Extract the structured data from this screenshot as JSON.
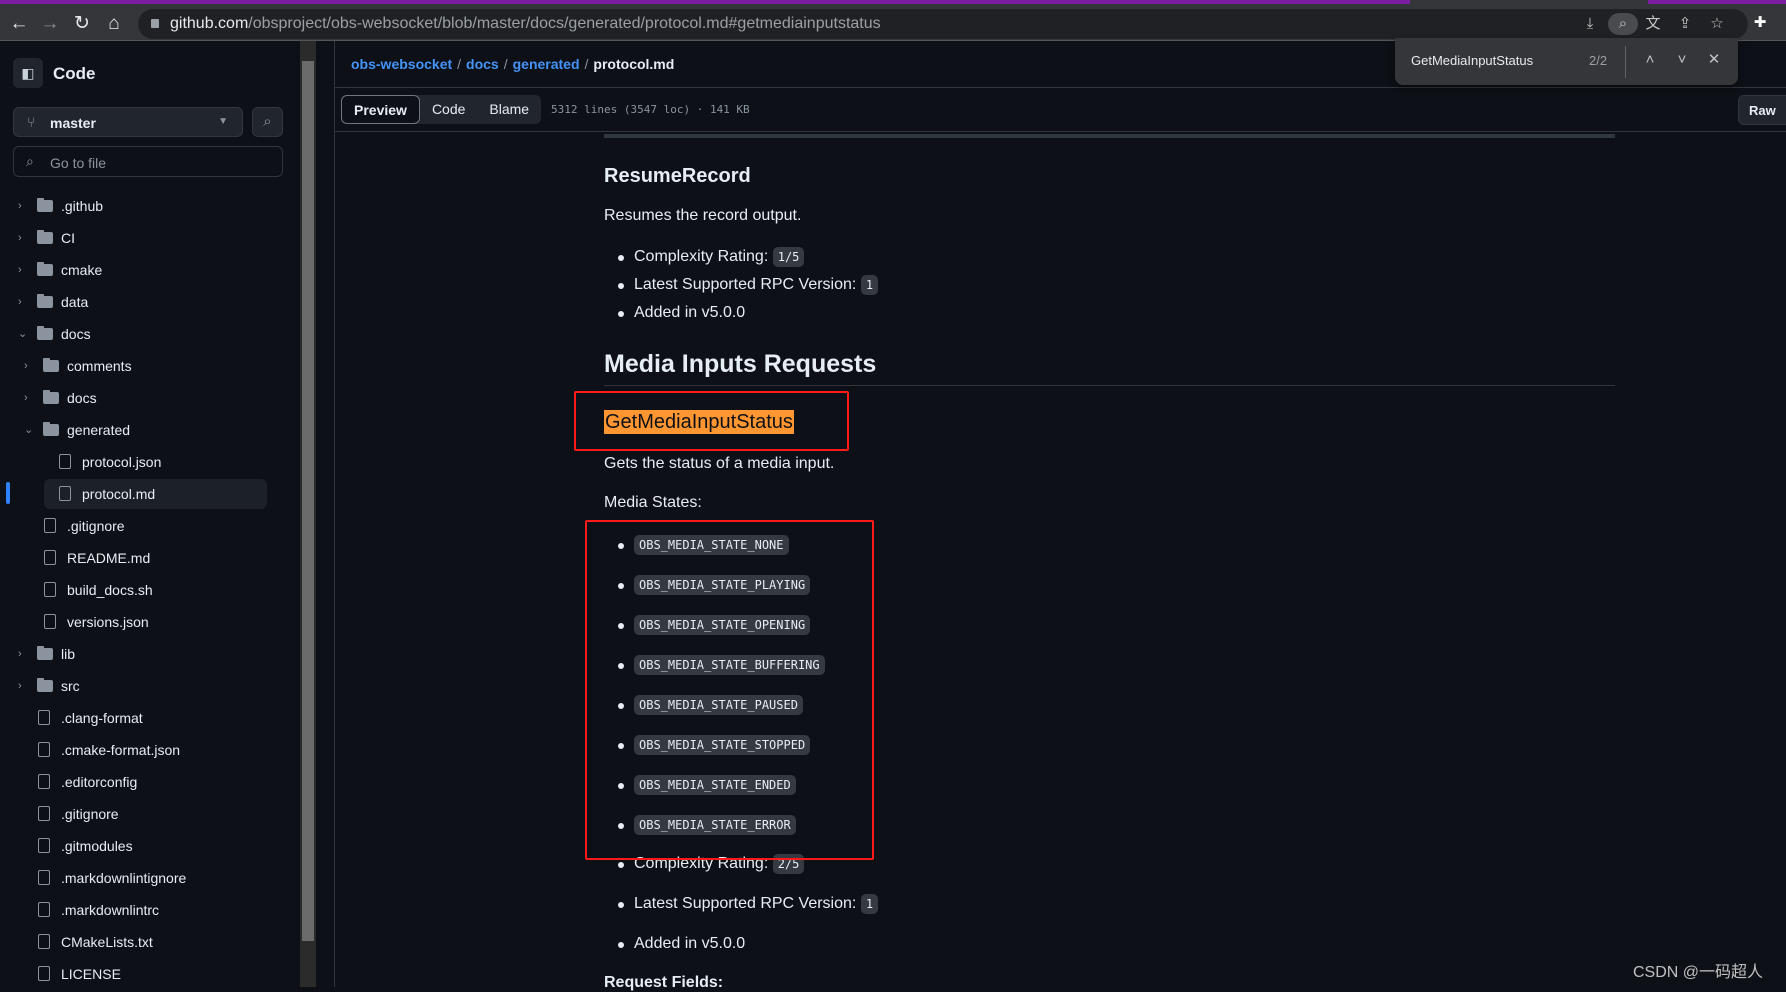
{
  "browser": {
    "url_host": "github.com",
    "url_path": "/obsproject/obs-websocket/blob/master/docs/generated/protocol.md#getmediainputstatus",
    "find": {
      "query": "GetMediaInputStatus",
      "count": "2/2"
    }
  },
  "sidebar": {
    "title": "Code",
    "branch": "master",
    "goto_placeholder": "Go to file",
    "items": [
      {
        "label": ".github",
        "type": "folder",
        "depth": 0,
        "expanded": false
      },
      {
        "label": "CI",
        "type": "folder",
        "depth": 0,
        "expanded": false
      },
      {
        "label": "cmake",
        "type": "folder",
        "depth": 0,
        "expanded": false
      },
      {
        "label": "data",
        "type": "folder",
        "depth": 0,
        "expanded": false
      },
      {
        "label": "docs",
        "type": "folder",
        "depth": 0,
        "expanded": true
      },
      {
        "label": "comments",
        "type": "folder",
        "depth": 1,
        "expanded": false
      },
      {
        "label": "docs",
        "type": "folder",
        "depth": 1,
        "expanded": false
      },
      {
        "label": "generated",
        "type": "folder",
        "depth": 1,
        "expanded": true
      },
      {
        "label": "protocol.json",
        "type": "file",
        "depth": 2
      },
      {
        "label": "protocol.md",
        "type": "file",
        "depth": 2,
        "selected": true
      },
      {
        "label": ".gitignore",
        "type": "file",
        "depth": 1
      },
      {
        "label": "README.md",
        "type": "file",
        "depth": 1
      },
      {
        "label": "build_docs.sh",
        "type": "file",
        "depth": 1
      },
      {
        "label": "versions.json",
        "type": "file",
        "depth": 1
      },
      {
        "label": "lib",
        "type": "folder",
        "depth": 0,
        "expanded": false
      },
      {
        "label": "src",
        "type": "folder",
        "depth": 0,
        "expanded": false
      },
      {
        "label": ".clang-format",
        "type": "file",
        "depth": 0
      },
      {
        "label": ".cmake-format.json",
        "type": "file",
        "depth": 0
      },
      {
        "label": ".editorconfig",
        "type": "file",
        "depth": 0
      },
      {
        "label": ".gitignore",
        "type": "file",
        "depth": 0
      },
      {
        "label": ".gitmodules",
        "type": "file",
        "depth": 0
      },
      {
        "label": ".markdownlintignore",
        "type": "file",
        "depth": 0
      },
      {
        "label": ".markdownlintrc",
        "type": "file",
        "depth": 0
      },
      {
        "label": "CMakeLists.txt",
        "type": "file",
        "depth": 0
      },
      {
        "label": "LICENSE",
        "type": "file",
        "depth": 0
      }
    ]
  },
  "header": {
    "breadcrumb": [
      "obs-websocket",
      "docs",
      "generated"
    ],
    "current_file": "protocol.md",
    "tabs": [
      "Preview",
      "Code",
      "Blame"
    ],
    "active_tab": "Preview",
    "file_info": "5312 lines (3547 loc) · 141 KB",
    "raw_label": "Raw"
  },
  "doc": {
    "resume": {
      "title": "ResumeRecord",
      "desc": "Resumes the record output.",
      "complexity_label": "Complexity Rating:",
      "complexity": "1/5",
      "rpc_label": "Latest Supported RPC Version:",
      "rpc": "1",
      "added": "Added in v5.0.0"
    },
    "section_title": "Media Inputs Requests",
    "media": {
      "title": "GetMediaInputStatus",
      "desc": "Gets the status of a media input.",
      "states_label": "Media States:",
      "states": [
        "OBS_MEDIA_STATE_NONE",
        "OBS_MEDIA_STATE_PLAYING",
        "OBS_MEDIA_STATE_OPENING",
        "OBS_MEDIA_STATE_BUFFERING",
        "OBS_MEDIA_STATE_PAUSED",
        "OBS_MEDIA_STATE_STOPPED",
        "OBS_MEDIA_STATE_ENDED",
        "OBS_MEDIA_STATE_ERROR"
      ],
      "complexity_label": "Complexity Rating:",
      "complexity": "2/5",
      "rpc_label": "Latest Supported RPC Version:",
      "rpc": "1",
      "added": "Added in v5.0.0",
      "next_heading": "Request Fields:"
    },
    "highlight_color": "#ff9632",
    "annotation_color": "#ff1a1a"
  },
  "watermark": "CSDN @一码超人"
}
